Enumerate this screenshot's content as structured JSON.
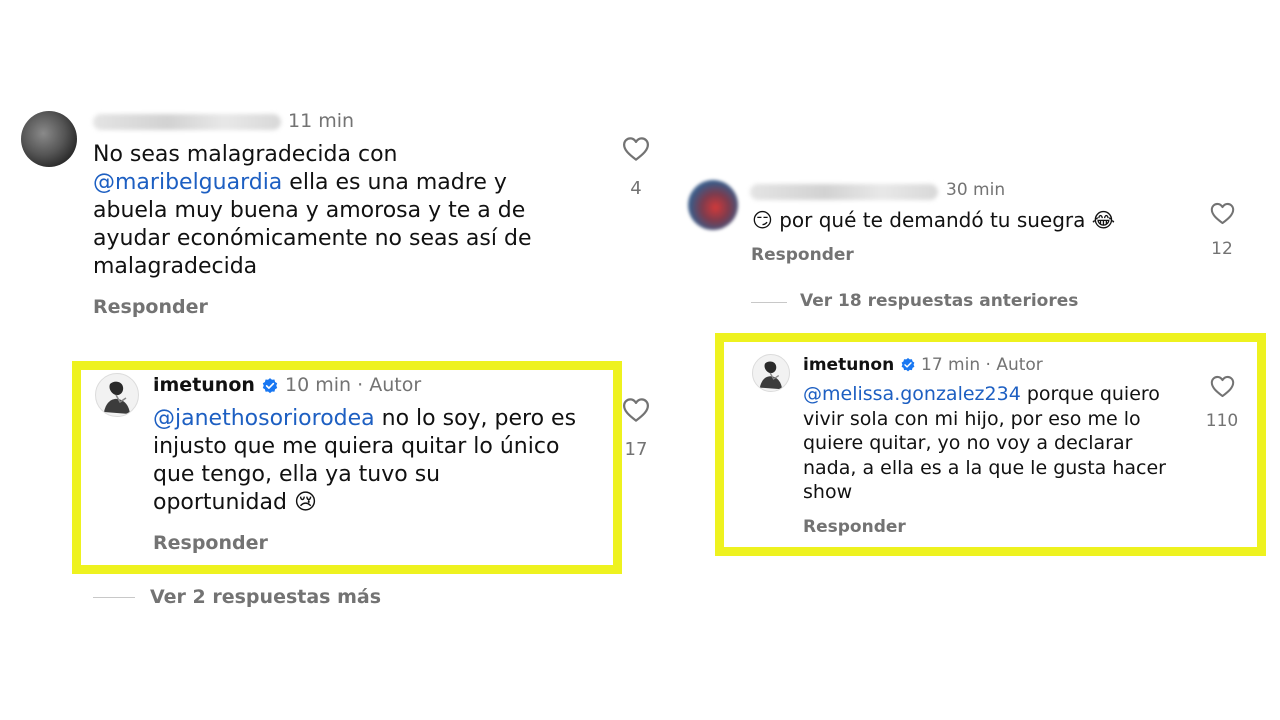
{
  "left": {
    "comment": {
      "time": "11 min",
      "mention": "@maribelguardia",
      "text_line1": "No seas malagradecida con",
      "text_line2_rest": " ella es una madre y",
      "text_line3": "abuela muy buena y amorosa y te a de",
      "text_line4": "ayudar económicamente no seas así de",
      "text_line5": "malagradecida",
      "reply_label": "Responder",
      "likes": "4"
    },
    "author_reply": {
      "username": "imetunon",
      "time": "10 min",
      "author_label": "Autor",
      "mention": "@janethosoriorodea",
      "text_line1_rest": " no lo soy, pero es",
      "text_line2": "injusto que me quiera quitar lo único",
      "text_line3": "que tengo, ella ya tuvo su",
      "text_line4": "oportunidad 😢",
      "reply_label": "Responder",
      "likes": "17"
    },
    "view_more": "Ver 2 respuestas más"
  },
  "right": {
    "comment": {
      "time": "30 min",
      "text": "😏 por qué te demandó tu suegra 😂",
      "reply_label": "Responder",
      "likes": "12"
    },
    "view_previous": "Ver 18 respuestas anteriores",
    "author_reply": {
      "username": "imetunon",
      "time": "17 min",
      "author_label": "Autor",
      "mention": "@melissa.gonzalez234",
      "text_line1_rest": " porque quiero",
      "text_line2": "vivir sola con mi hijo, por eso me lo",
      "text_line3": "quiere quitar, yo no voy a declarar",
      "text_line4": "nada, a ella es a la que le gusta hacer",
      "text_line5": "show",
      "reply_label": "Responder",
      "likes": "110"
    }
  },
  "colors": {
    "highlight": "#eef21f",
    "mention": "#1d5fc2",
    "muted": "#737373",
    "verified": "#1877f2"
  },
  "separator": "·"
}
